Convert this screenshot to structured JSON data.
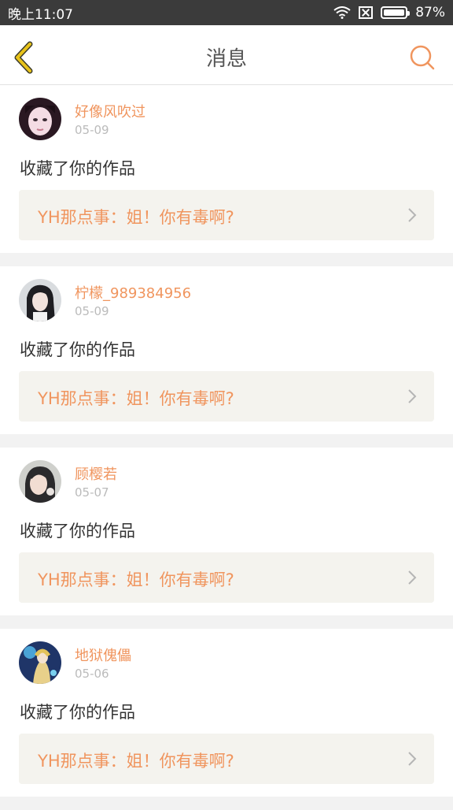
{
  "status_bar": {
    "time": "晚上11:07",
    "battery": "87%",
    "battery_level": 0.87,
    "icons": [
      "wifi-icon",
      "sim-off-icon",
      "battery-icon"
    ]
  },
  "nav": {
    "title": "消息",
    "back_icon": "chevron-left-icon",
    "search_icon": "search-icon",
    "accent_color": "#f0955e",
    "back_color": "#e8c31a"
  },
  "messages": [
    {
      "username": "好像风吹过",
      "date": "05-09",
      "action": "收藏了你的作品",
      "work": "YH那点事：姐！你有毒啊?"
    },
    {
      "username": "柠檬_989384956",
      "date": "05-09",
      "action": "收藏了你的作品",
      "work": "YH那点事：姐！你有毒啊?"
    },
    {
      "username": "顾樱若",
      "date": "05-07",
      "action": "收藏了你的作品",
      "work": "YH那点事：姐！你有毒啊?"
    },
    {
      "username": "地狱傀儡",
      "date": "05-06",
      "action": "收藏了你的作品",
      "work": "YH那点事：姐！你有毒啊?"
    }
  ]
}
